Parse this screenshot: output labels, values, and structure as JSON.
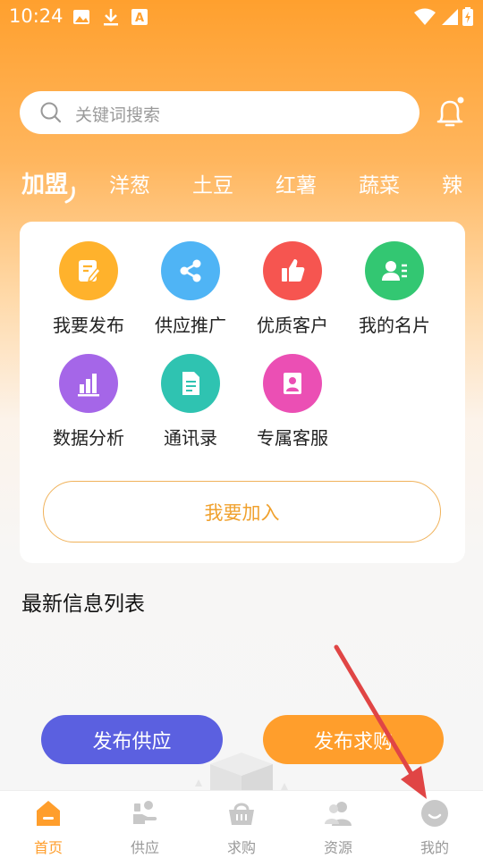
{
  "status": {
    "time": "10:24"
  },
  "search": {
    "placeholder": "关键词搜索"
  },
  "categories": [
    "加盟",
    "洋葱",
    "土豆",
    "红薯",
    "蔬菜",
    "辣"
  ],
  "grid": [
    {
      "label": "我要发布",
      "color": "#FFB22C",
      "icon": "edit-icon"
    },
    {
      "label": "供应推广",
      "color": "#4FB4F5",
      "icon": "share-icon"
    },
    {
      "label": "优质客户",
      "color": "#F65550",
      "icon": "thumbs-up-icon"
    },
    {
      "label": "我的名片",
      "color": "#33C772",
      "icon": "contact-card-icon"
    },
    {
      "label": "数据分析",
      "color": "#A566E8",
      "icon": "bar-chart-icon"
    },
    {
      "label": "通讯录",
      "color": "#2FC3B1",
      "icon": "document-icon"
    },
    {
      "label": "专属客服",
      "color": "#EB4FB4",
      "icon": "customer-service-icon"
    }
  ],
  "join_label": "我要加入",
  "section_title": "最新信息列表",
  "fab": {
    "supply": "发布供应",
    "demand": "发布求购"
  },
  "tabs": [
    {
      "label": "首页",
      "icon": "home-icon",
      "active": true
    },
    {
      "label": "供应",
      "icon": "supply-icon"
    },
    {
      "label": "求购",
      "icon": "basket-icon"
    },
    {
      "label": "资源",
      "icon": "people-icon"
    },
    {
      "label": "我的",
      "icon": "profile-icon"
    }
  ],
  "colors": {
    "accent": "#FF9E2C",
    "supply_button": "#5B60E0",
    "annotation_arrow": "#E04545"
  }
}
